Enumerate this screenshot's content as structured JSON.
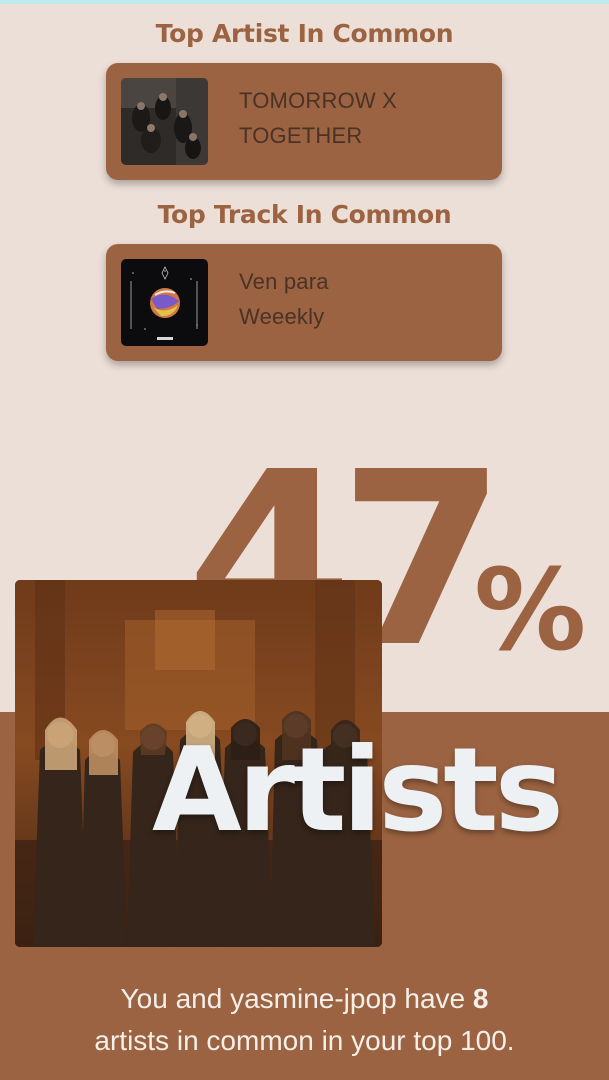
{
  "top_artist": {
    "heading": "Top Artist In Common",
    "line1": "TOMORROW X",
    "line2": "TOGETHER"
  },
  "top_track": {
    "heading": "Top Track In Common",
    "title": "Ven para",
    "artist": "Weeekly"
  },
  "match": {
    "percent_value": "47",
    "percent_sign": "%",
    "category": "Artists"
  },
  "summary": {
    "text_before": "You and yasmine-jpop have ",
    "count": "8",
    "text_after": "artists in common in your top 100."
  },
  "colors": {
    "background": "#ecdfd7",
    "accent": "#9b6341",
    "card_text": "#4a3225",
    "headline_text": "#eef1f4"
  },
  "icons": {
    "artist_image": "group-photo",
    "track_image": "album-cover",
    "hero_image": "group-photo"
  }
}
